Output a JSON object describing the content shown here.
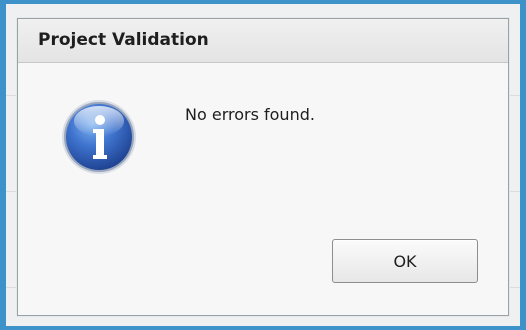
{
  "dialog": {
    "title": "Project Validation",
    "message": "No errors found.",
    "icon": "info-icon",
    "ok_label": "OK"
  },
  "colors": {
    "frame_accent": "#3d92ca",
    "icon_blue": "#2f5fb3"
  }
}
